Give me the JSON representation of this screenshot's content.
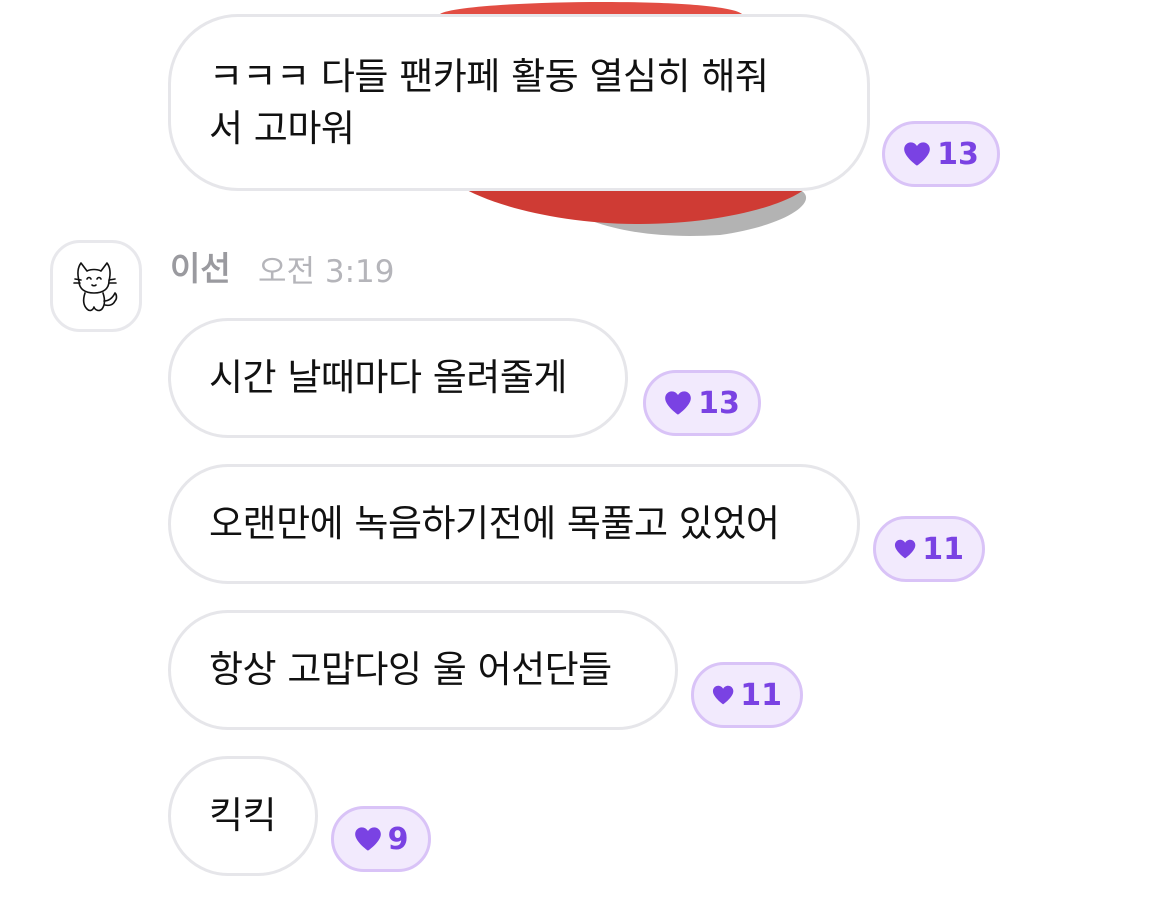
{
  "colors": {
    "bubble_border": "#e6e6ea",
    "text": "#111111",
    "like_bg": "#f2eafd",
    "like_border": "#d9c3f7",
    "like_accent": "#7a42e3",
    "sticker_red": "#e24d43",
    "meta_gray": "#9a9a9f"
  },
  "messages_prev": [
    {
      "line1": "ㅋㅋㅋ 다들 팬카페 활동 열심히 해줘",
      "line2": "서 고마워",
      "likes": "13",
      "like_icon": "heart-icon"
    }
  ],
  "sender": {
    "name": "이선",
    "time": "오전 3:19",
    "avatar_icon": "cat-doodle-avatar"
  },
  "messages": [
    {
      "text": "시간 날때마다 올려줄게",
      "likes": "13",
      "like_icon": "heart-icon"
    },
    {
      "text": "오랜만에 녹음하기전에 목풀고 있었어",
      "likes": "11",
      "like_icon": "heart-icon"
    },
    {
      "text": "항상 고맙다잉 울 어선단들",
      "likes": "11",
      "like_icon": "heart-icon"
    },
    {
      "text": "킥킥",
      "likes": "9",
      "like_icon": "heart-icon"
    }
  ]
}
